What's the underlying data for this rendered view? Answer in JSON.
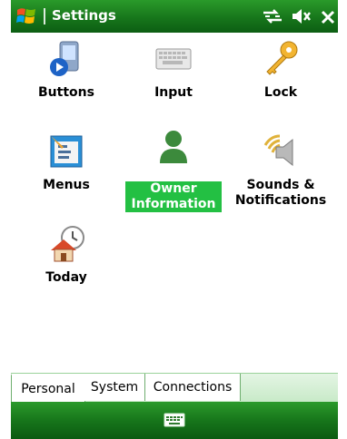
{
  "window": {
    "title": "Settings"
  },
  "items": [
    {
      "label": "Buttons",
      "icon": "buttons-icon"
    },
    {
      "label": "Input",
      "icon": "keyboard-icon"
    },
    {
      "label": "Lock",
      "icon": "key-icon"
    },
    {
      "label": "Menus",
      "icon": "menus-icon"
    },
    {
      "label": "Owner\nInformation",
      "label_line1": "Owner",
      "label_line2": "Information",
      "icon": "owner-icon"
    },
    {
      "label_line1": "Sounds &",
      "label_line2": "Notifications",
      "icon": "speaker-icon"
    },
    {
      "label": "Today",
      "icon": "home-clock-icon"
    }
  ],
  "tabs": [
    {
      "label": "Personal"
    },
    {
      "label": "System"
    },
    {
      "label": "Connections"
    }
  ],
  "colors": {
    "bar_green": "#17761b",
    "selection_green": "#23c043",
    "tab_border": "#6fae6f"
  }
}
